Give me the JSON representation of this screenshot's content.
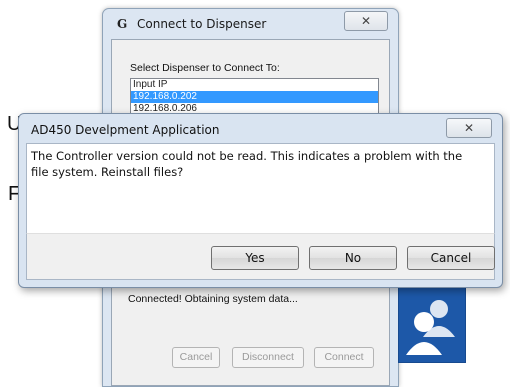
{
  "connect_window": {
    "title": "Connect to Dispenser",
    "app_icon_glyph": "G",
    "close_glyph": "✕",
    "prompt": "Select Dispenser to Connect To:",
    "list_items": [
      {
        "label": "Input IP",
        "selected": false
      },
      {
        "label": "192.168.0.202",
        "selected": true
      },
      {
        "label": "192.168.0.206",
        "selected": false
      }
    ],
    "status": "Connected! Obtaining system data...",
    "buttons": {
      "cancel": "Cancel",
      "disconnect": "Disconnect",
      "connect": "Connect"
    }
  },
  "background_app": {
    "char_1": "U",
    "char_2": "F"
  },
  "dialog": {
    "title": "AD450 Develpment Application",
    "close_glyph": "✕",
    "message": "The Controller version could not be read. This indicates a problem with the file system. Reinstall files?",
    "buttons": {
      "yes": "Yes",
      "no": "No",
      "cancel": "Cancel"
    }
  },
  "colors": {
    "selection": "#3399ff",
    "avatar_tile": "#1d58a8"
  },
  "icons": {
    "avatar": "users-icon"
  }
}
